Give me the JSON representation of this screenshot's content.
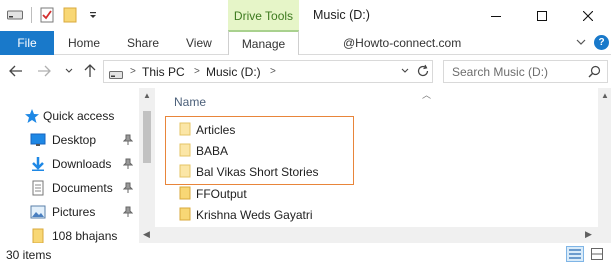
{
  "window": {
    "title": "Music (D:)",
    "contextual_tab": "Drive Tools",
    "minimize_icon": "minimize-icon",
    "maximize_icon": "maximize-icon",
    "close_icon": "close-icon"
  },
  "ribbon": {
    "tabs": [
      "File",
      "Home",
      "Share",
      "View",
      "Manage"
    ],
    "watermark": "@Howto-connect.com",
    "accent": "#1979ca",
    "contextual_accent": "#a9d18e"
  },
  "address": {
    "crumbs": [
      "This PC",
      "Music (D:)"
    ]
  },
  "search": {
    "placeholder": "Search Music (D:)"
  },
  "nav_pane": {
    "items": [
      {
        "label": "Quick access",
        "icon": "star-icon",
        "pinned": false
      },
      {
        "label": "Desktop",
        "icon": "desktop-icon",
        "pinned": true
      },
      {
        "label": "Downloads",
        "icon": "download-icon",
        "pinned": true
      },
      {
        "label": "Documents",
        "icon": "documents-icon",
        "pinned": true
      },
      {
        "label": "Pictures",
        "icon": "pictures-icon",
        "pinned": true
      },
      {
        "label": "108 bhajans",
        "icon": "folder-icon",
        "pinned": false
      }
    ]
  },
  "content": {
    "column_header": "Name",
    "files": [
      {
        "name": "Articles"
      },
      {
        "name": "BABA"
      },
      {
        "name": "Bal Vikas Short Stories"
      },
      {
        "name": "FFOutput"
      },
      {
        "name": "Krishna Weds Gayatri"
      }
    ],
    "highlight_color": "#e8853a"
  },
  "status_bar": {
    "item_count": "30 items"
  }
}
